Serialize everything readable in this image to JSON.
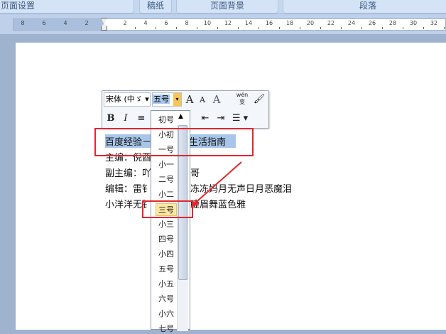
{
  "ribbon": {
    "groups": [
      "页面设置",
      "稿纸",
      "页面背景",
      "段落"
    ]
  },
  "ruler": {
    "neg_ticks": [
      "8",
      "6",
      "4",
      "2"
    ],
    "pos_ticks": [
      "2",
      "4",
      "6",
      "8",
      "10",
      "12",
      "14",
      "16",
      "18",
      "20",
      "22",
      "24",
      "26",
      "28",
      "30",
      "32"
    ]
  },
  "mini_toolbar": {
    "font_name": "宋体 (中ゞ",
    "font_size": "五号",
    "grow_icon": "A",
    "shrink_icon": "A",
    "style_icon": "A",
    "phonetic": "wén 变",
    "bold": "B",
    "italic": "I"
  },
  "size_dropdown": {
    "items": [
      "初号",
      "小初",
      "一号",
      "小一",
      "二号",
      "小二",
      "三号",
      "小三",
      "四号",
      "小四",
      "五号",
      "小五",
      "六号",
      "小六",
      "七号"
    ],
    "highlighted": "三号"
  },
  "document": {
    "lines": [
      {
        "left": "百度经验－",
        "right": "生活指南"
      },
      {
        "left": "主编：倪酉",
        "right": ""
      },
      {
        "left": "副主编：吖",
        "right": "哥"
      },
      {
        "left": "编辑：雷钅",
        "right": "冻冻妈月无声日月恶魔泪"
      },
      {
        "left": "小洋洋无钅",
        "right": "睫眉舞蓝色雅"
      }
    ]
  },
  "colors": {
    "annotation": "#e3262d",
    "selection": "#a8c6ea"
  }
}
